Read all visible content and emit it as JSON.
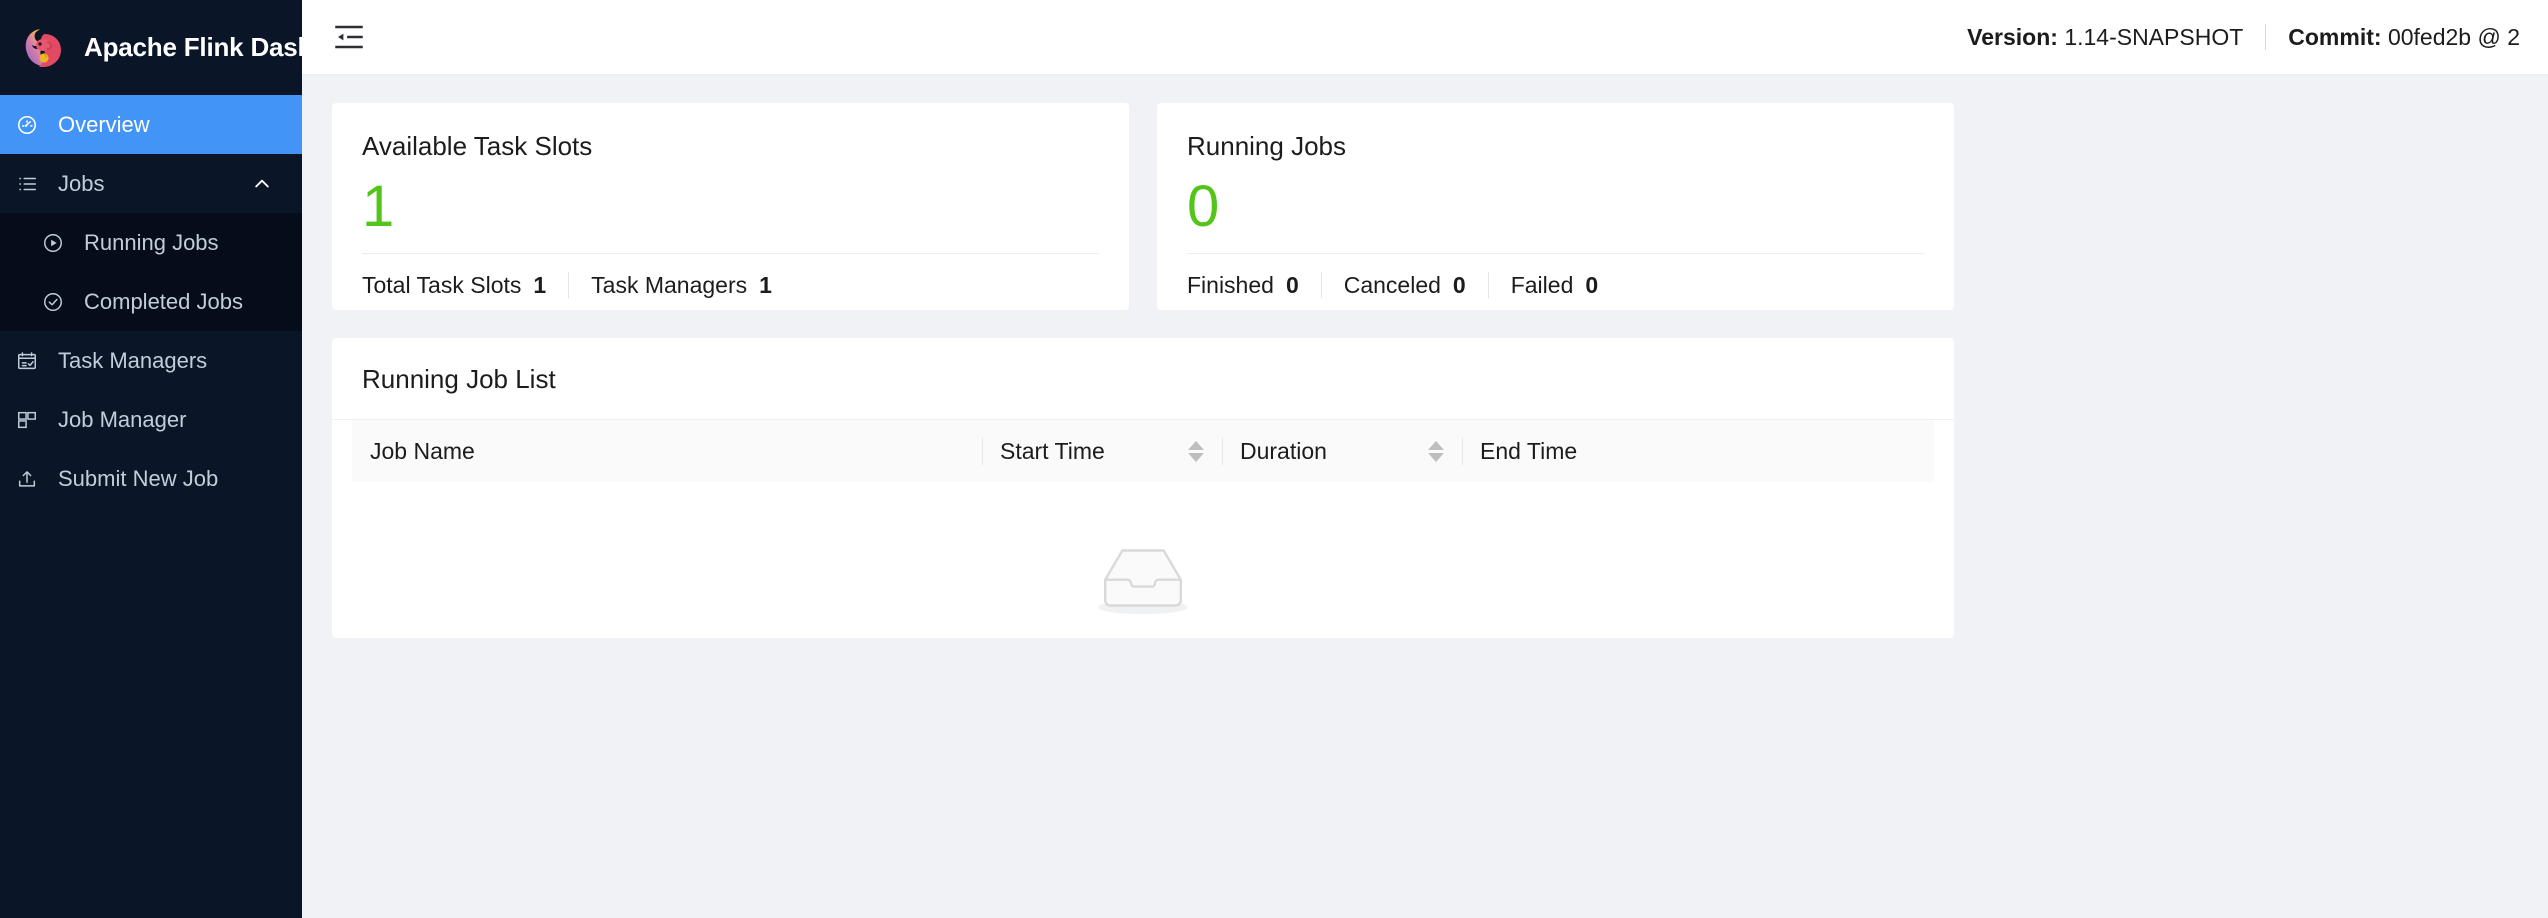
{
  "brand": {
    "title": "Apache Flink Dashboard",
    "logo_icon": "flink-squirrel-logo"
  },
  "sidebar": {
    "items": [
      {
        "label": "Overview",
        "icon": "dashboard-gauge-icon",
        "active": true
      },
      {
        "label": "Jobs",
        "icon": "ordered-list-icon",
        "expanded": true,
        "caret": "chevron-up-icon"
      },
      {
        "label": "Running Jobs",
        "icon": "play-circle-icon",
        "sub": true
      },
      {
        "label": "Completed Jobs",
        "icon": "check-circle-icon",
        "sub": true
      },
      {
        "label": "Task Managers",
        "icon": "schedule-check-icon"
      },
      {
        "label": "Job Manager",
        "icon": "block-layout-icon"
      },
      {
        "label": "Submit New Job",
        "icon": "upload-icon"
      }
    ]
  },
  "topbar": {
    "fold_icon": "menu-fold-icon",
    "version_label": "Version:",
    "version_value": "1.14-SNAPSHOT",
    "commit_label": "Commit:",
    "commit_value": "00fed2b @ 2"
  },
  "cards": {
    "slots": {
      "title": "Available Task Slots",
      "value": "1",
      "value_color": "#52c41a",
      "footer": [
        {
          "label": "Total Task Slots",
          "value": "1"
        },
        {
          "label": "Task Managers",
          "value": "1"
        }
      ]
    },
    "jobs": {
      "title": "Running Jobs",
      "value": "0",
      "value_color": "#52c41a",
      "footer": [
        {
          "label": "Finished",
          "value": "0"
        },
        {
          "label": "Canceled",
          "value": "0"
        },
        {
          "label": "Failed",
          "value": "0"
        }
      ]
    }
  },
  "job_list": {
    "title": "Running Job List",
    "columns": [
      {
        "label": "Job Name",
        "sortable": false
      },
      {
        "label": "Start Time",
        "sortable": true
      },
      {
        "label": "Duration",
        "sortable": true
      },
      {
        "label": "End Time",
        "sortable": false
      }
    ],
    "rows": [],
    "empty_icon": "empty-inbox-icon"
  }
}
